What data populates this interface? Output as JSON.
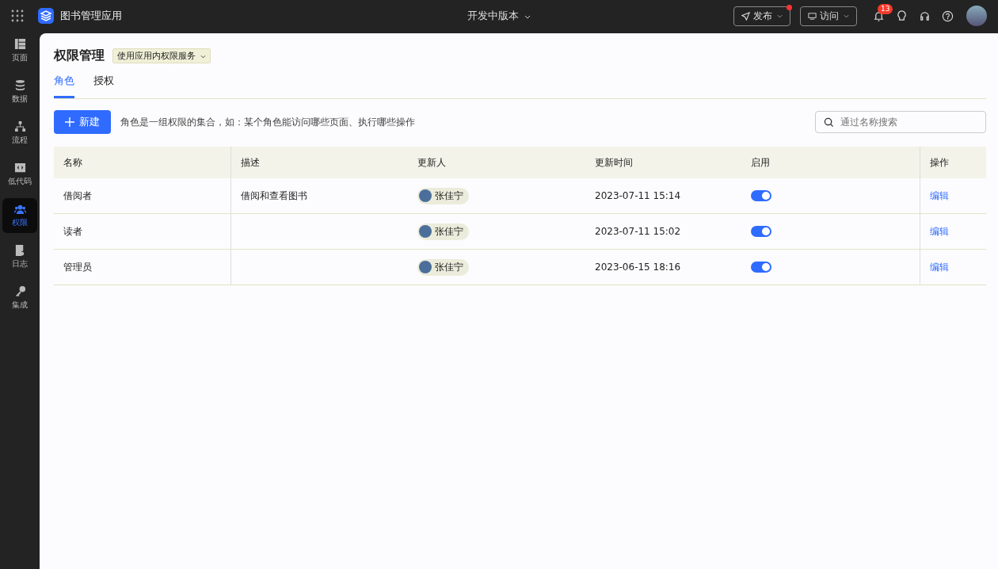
{
  "app": {
    "name": "图书管理应用",
    "version": "开发中版本"
  },
  "topbar": {
    "publish": {
      "label": "发布",
      "dot": true
    },
    "visit": {
      "label": "访问"
    },
    "notifications": "13"
  },
  "sidebar": {
    "items": [
      {
        "label": "页面",
        "selected": false
      },
      {
        "label": "数据",
        "selected": false
      },
      {
        "label": "流程",
        "selected": false
      },
      {
        "label": "低代码",
        "selected": false
      },
      {
        "label": "权限",
        "selected": true
      },
      {
        "label": "日志",
        "selected": false
      },
      {
        "label": "集成",
        "selected": false
      }
    ]
  },
  "page": {
    "title": "权限管理",
    "service": "使用应用内权限服务"
  },
  "tabs": [
    {
      "label": "角色",
      "selected": true
    },
    {
      "label": "授权",
      "selected": false
    }
  ],
  "toolbar": {
    "new_button": "新建",
    "hint": "角色是一组权限的集合，如：某个角色能访问哪些页面、执行哪些操作",
    "search": {
      "placeholder": "通过名称搜索"
    }
  },
  "table": {
    "columns": [
      "名称",
      "描述",
      "更新人",
      "更新时间",
      "启用",
      "操作"
    ],
    "rows": [
      {
        "name": "借阅者",
        "description": "借阅和查看图书",
        "updater": "张佳宁",
        "updated": "2023-07-11 15:14",
        "enabled": true,
        "action": "编辑"
      },
      {
        "name": "读者",
        "description": "",
        "updater": "张佳宁",
        "updated": "2023-07-11 15:02",
        "enabled": true,
        "action": "编辑"
      },
      {
        "name": "管理员",
        "description": "",
        "updater": "张佳宁",
        "updated": "2023-06-15 18:16",
        "enabled": true,
        "action": "编辑"
      }
    ]
  }
}
